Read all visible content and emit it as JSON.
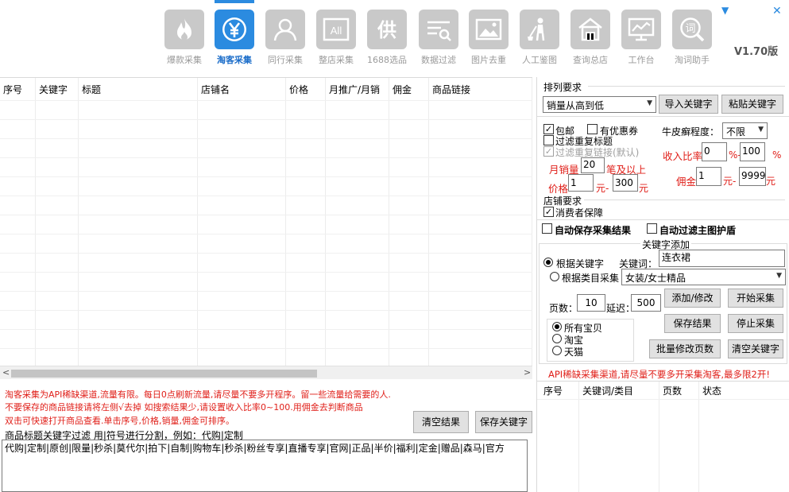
{
  "toolbar": {
    "items": [
      {
        "label": "爆款采集",
        "icon": "flame-icon"
      },
      {
        "label": "淘客采集",
        "icon": "yen-icon"
      },
      {
        "label": "同行采集",
        "icon": "user-icon"
      },
      {
        "label": "整店采集",
        "icon": "all-icon"
      },
      {
        "label": "1688选品",
        "icon": "gong-icon"
      },
      {
        "label": "数据过滤",
        "icon": "filter-search-icon"
      },
      {
        "label": "图片去重",
        "icon": "image-icon"
      },
      {
        "label": "人工鉴图",
        "icon": "cleaner-icon"
      },
      {
        "label": "查询总店",
        "icon": "store-icon"
      },
      {
        "label": "工作台",
        "icon": "monitor-chart-icon"
      },
      {
        "label": "淘词助手",
        "icon": "word-search-icon"
      }
    ],
    "active_index": 1,
    "all_icon_text": "All",
    "gong_icon_text": "供",
    "word_icon_text": "词"
  },
  "version": "V1.70版",
  "window": {
    "dropdown_glyph": "▼",
    "close_glyph": "✕"
  },
  "grid": {
    "columns": [
      "序号",
      "关键字",
      "标题",
      "店铺名",
      "价格",
      "月推广/月销",
      "佣金",
      "商品链接"
    ]
  },
  "scroll": {
    "left_arrow": "<",
    "right_arrow": ">"
  },
  "notices": [
    "淘客采集为API稀缺渠道,流量有限。每日0点刷新流量,请尽量不要多开程序。留一些流量给需要的人.",
    "不要保存的商品链接请将左侧√去掉  如搜索结果少,请设置收入比率0~100.用佣金去判断商品",
    "双击可快速打开商品查看.单击序号,价格,销量,佣金可排序。"
  ],
  "buttons": {
    "clear_results": "清空结果",
    "save_keywords_left": "保存关键字",
    "import_keywords": "导入关键字",
    "paste_keywords": "粘贴关键字",
    "add_modify": "添加/修改",
    "start_collect": "开始采集",
    "save_results": "保存结果",
    "stop_collect": "停止采集",
    "batch_modify_pages": "批量修改页数",
    "clear_keywords": "清空关键字"
  },
  "filter_text": {
    "label": "商品标题关键字过滤 用|符号进行分割，例如：代购|定制",
    "value": "代购|定制|原创|限量|秒杀|莫代尔|拍下|自制|购物车|秒杀|粉丝专享|直播专享|官网|正品|半价|福利|定金|赠品|森马|官方"
  },
  "sort": {
    "title": "排列要求",
    "selected": "销量从高到低"
  },
  "options": {
    "free_shipping": "包邮",
    "has_coupon": "有优惠券",
    "filter_dup_title": "过滤重复标题",
    "filter_dup_link": "过滤重复链接(默认)",
    "psoriasis_label": "牛皮癣程度：",
    "psoriasis_value": "不限",
    "income_ratio_label": "收入比率",
    "income_min": "0",
    "income_max": "100",
    "percent": "%",
    "percent_dash": "%-",
    "monthly_sales_label": "月销量",
    "monthly_sales_value": "20",
    "monthly_sales_suffix": "笔及以上",
    "price_label": "价格",
    "price_min": "1",
    "price_max": "300",
    "yuan": "元",
    "yuan_dash": "元-",
    "commission_label": "佣金",
    "commission_min": "1",
    "commission_max": "9999"
  },
  "store": {
    "title": "店铺要求",
    "consumer_protection": "消费者保障",
    "auto_save": "自动保存采集结果",
    "auto_filter_shield": "自动过滤主图护盾"
  },
  "keyword_add": {
    "title": "关键字添加",
    "by_keyword": "根据关键字",
    "keyword_label": "关键词：",
    "keyword_value": "连衣裙",
    "by_category": "根据类目采集",
    "category_value": "女装/女士精品",
    "pages_label": "页数：",
    "pages_value": "10",
    "delay_label": "延迟：",
    "delay_value": "500"
  },
  "shop_type": {
    "all": "所有宝贝",
    "taobao": "淘宝",
    "tmall": "天猫"
  },
  "api_notice": "API稀缺采集渠道,请尽量不要多开采集淘客,最多限2开!",
  "task_table": {
    "columns": [
      "序号",
      "关键词/类目",
      "页数",
      "状态"
    ]
  },
  "colors": {
    "accent": "#2b8be0",
    "warning": "#e0201a",
    "icon_gray": "#c9c9c9"
  }
}
